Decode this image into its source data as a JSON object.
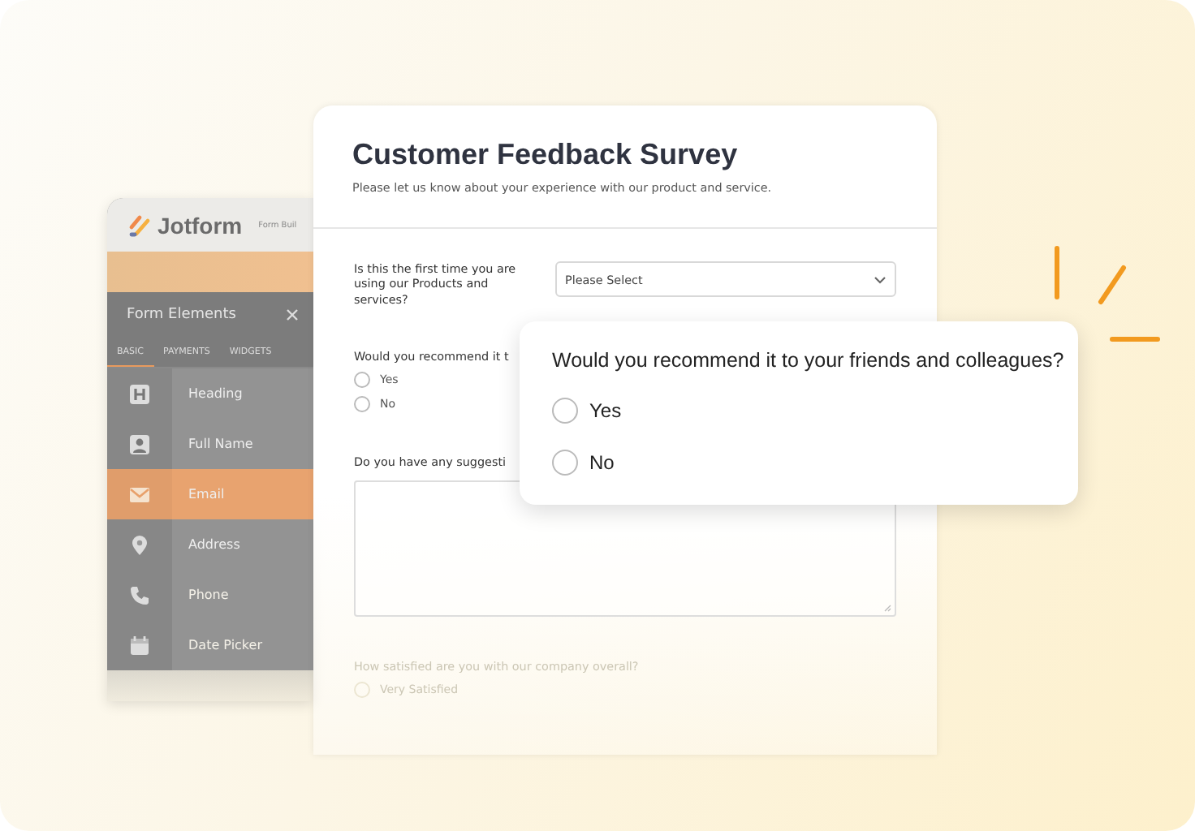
{
  "builder_panel": {
    "logo": "Jotform",
    "subtitle": "Form Buil",
    "title": "Form Elements",
    "tabs": [
      {
        "label": "BASIC",
        "selected": true
      },
      {
        "label": "PAYMENTS",
        "selected": false
      },
      {
        "label": "WIDGETS",
        "selected": false
      }
    ],
    "elements": [
      {
        "kind": "heading",
        "label": "Heading",
        "selected": false
      },
      {
        "kind": "person",
        "label": "Full Name",
        "selected": false
      },
      {
        "kind": "email",
        "label": "Email",
        "selected": true
      },
      {
        "kind": "pin",
        "label": "Address",
        "selected": false
      },
      {
        "kind": "phone",
        "label": "Phone",
        "selected": false
      },
      {
        "kind": "calendar",
        "label": "Date Picker",
        "selected": false
      }
    ]
  },
  "form": {
    "title": "Customer Feedback Survey",
    "description": "Please let us know about your experience with our product and service.",
    "questions": [
      {
        "kind": "dropdown",
        "label": "Is this the first time you are using our Products and services?",
        "value": "Please Select",
        "faded": false
      },
      {
        "kind": "radio",
        "label": "Would you recommend it t",
        "faded": false,
        "options": [
          {
            "label": "Yes",
            "selected": false
          },
          {
            "label": "No",
            "selected": false
          }
        ]
      },
      {
        "kind": "textarea",
        "label": "Do you have any suggesti",
        "faded": false
      },
      {
        "kind": "radio",
        "label": "How satisfied are you with our company overall?",
        "faded": true,
        "options": [
          {
            "label": "Very Satisfied",
            "selected": false
          }
        ]
      }
    ]
  },
  "popup": {
    "question": "Would you recommend it to your friends and colleagues?",
    "options": [
      {
        "label": "Yes",
        "selected": false
      },
      {
        "label": "No",
        "selected": false
      }
    ]
  }
}
